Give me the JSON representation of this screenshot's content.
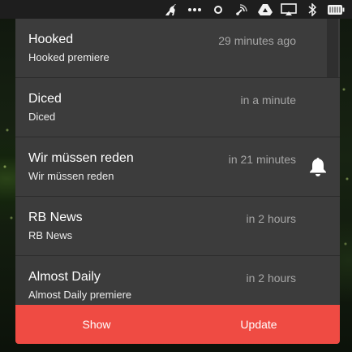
{
  "menubar": {
    "icons": [
      "kangaroo-icon",
      "ellipsis-icon",
      "circle-icon",
      "broadcast-icon",
      "google-drive-icon",
      "airplay-icon",
      "bluetooth-icon",
      "battery-icon"
    ]
  },
  "shows": [
    {
      "title": "Hooked",
      "subtitle": "Hooked premiere",
      "time": "29 minutes ago",
      "reminder": false
    },
    {
      "title": "Diced",
      "subtitle": "Diced",
      "time": "in a minute",
      "reminder": false
    },
    {
      "title": "Wir müssen reden",
      "subtitle": "Wir müssen reden",
      "time": "in 21 minutes",
      "reminder": true
    },
    {
      "title": "RB News",
      "subtitle": "RB News",
      "time": "in 2 hours",
      "reminder": false
    },
    {
      "title": "Almost Daily",
      "subtitle": "Almost Daily premiere",
      "time": "in 2 hours",
      "reminder": false
    }
  ],
  "footer": {
    "show_label": "Show",
    "update_label": "Update"
  },
  "colors": {
    "accent": "#ef4b43",
    "panel": "#3c3c3c"
  }
}
